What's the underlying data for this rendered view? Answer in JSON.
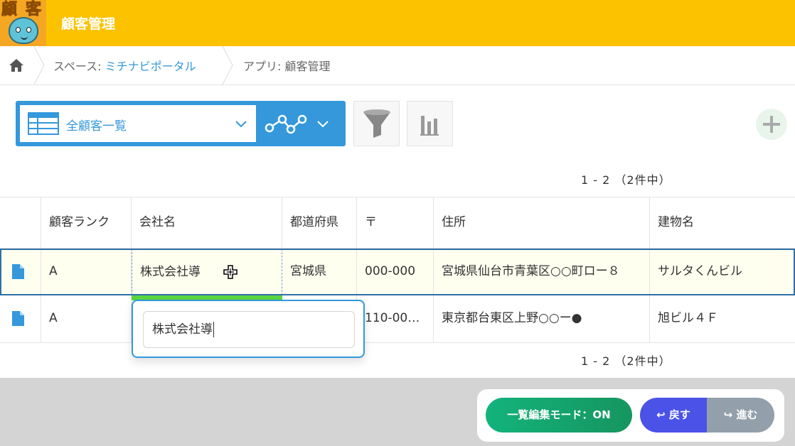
{
  "header": {
    "app_title": "顧客管理",
    "icon_text": [
      "顧",
      "客"
    ],
    "color": "#fcc200"
  },
  "breadcrumb": {
    "home_icon": "home-icon",
    "space_prefix": "スペース: ",
    "space_name": "ミチナビポータル",
    "app_prefix": "アプリ: ",
    "app_name": "顧客管理"
  },
  "toolbar": {
    "view_name": "全顧客一覧",
    "icons": [
      "list-view-icon",
      "chevron-down-icon",
      "graph-icon",
      "filter-icon",
      "bar-chart-icon",
      "plus-icon"
    ]
  },
  "pagination": {
    "top": "1 - 2 （2件中）",
    "bottom": "1 - 2 （2件中）"
  },
  "table": {
    "columns": [
      "",
      "顧客ランク",
      "会社名",
      "都道府県",
      "〒",
      "住所",
      "建物名"
    ],
    "rows": [
      {
        "rank": "A",
        "company": "株式会社導",
        "prefecture": "宮城県",
        "postal": "000-000",
        "address": "宮城県仙台市青葉区○○町ロー８",
        "building": "サルタくんビル"
      },
      {
        "rank": "A",
        "company": "",
        "prefecture": "",
        "postal": "110-00…",
        "address": "東京都台東区上野○○ー●",
        "building": "旭ビル４Ｆ"
      }
    ]
  },
  "editor": {
    "value": "株式会社導"
  },
  "footer": {
    "edit_mode_label": "一覧編集モード：ON",
    "undo_label": "↩ 戻す",
    "redo_label": "↪ 進む"
  },
  "colors": {
    "accent": "#3498db",
    "edit_mode": "#13b37c",
    "undo": "#4a52e8",
    "redo": "#93a0ab"
  }
}
